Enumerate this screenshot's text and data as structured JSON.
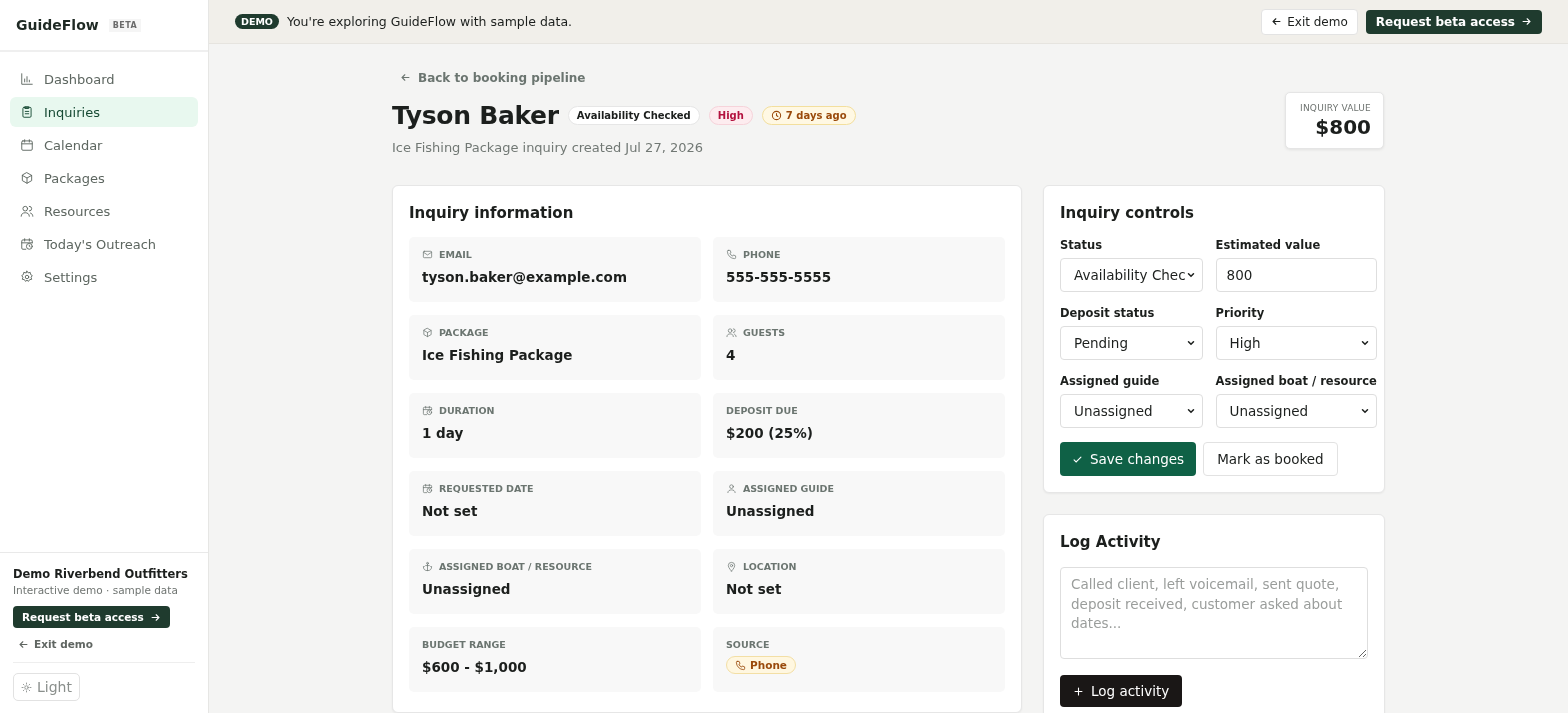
{
  "sidebar": {
    "brand": "GuideFlow",
    "brand_badge": "BETA",
    "items": [
      {
        "label": "Dashboard",
        "selected": false
      },
      {
        "label": "Inquiries",
        "selected": true
      },
      {
        "label": "Calendar",
        "selected": false
      },
      {
        "label": "Packages",
        "selected": false
      },
      {
        "label": "Resources",
        "selected": false
      },
      {
        "label": "Today's Outreach",
        "selected": false
      },
      {
        "label": "Settings",
        "selected": false
      }
    ],
    "org_name": "Demo Riverbend Outfitters",
    "org_note": "Interactive demo · sample data",
    "request_button": "Request beta access",
    "exit_link": "Exit demo",
    "theme_button": "Light"
  },
  "banner": {
    "badge": "DEMO",
    "message": "You're exploring GuideFlow with sample data.",
    "exit_button": "Exit demo",
    "request_button": "Request beta access"
  },
  "header": {
    "back_link": "Back to booking pipeline",
    "title": "Tyson Baker",
    "tags": [
      {
        "kind": "status",
        "label": "Availability Checked"
      },
      {
        "kind": "priority",
        "label": "High"
      },
      {
        "kind": "age",
        "label": "7 days ago"
      }
    ],
    "subtitle": "Ice Fishing Package inquiry created Jul 27, 2026",
    "value_label": "INQUIRY VALUE",
    "value": "$800"
  },
  "info": {
    "title": "Inquiry information",
    "fields": [
      {
        "label": "EMAIL",
        "value": "tyson.baker@example.com",
        "kind": "text"
      },
      {
        "label": "PHONE",
        "value": "555-555-5555",
        "kind": "text"
      },
      {
        "label": "PACKAGE",
        "value": "Ice Fishing Package",
        "kind": "text"
      },
      {
        "label": "GUESTS",
        "value": "4",
        "kind": "text"
      },
      {
        "label": "DURATION",
        "value": "1 day",
        "kind": "text"
      },
      {
        "label": "DEPOSIT DUE",
        "value": "$200 (25%)",
        "kind": "text"
      },
      {
        "label": "REQUESTED DATE",
        "value": "Not set",
        "kind": "text"
      },
      {
        "label": "ASSIGNED GUIDE",
        "value": "Unassigned",
        "kind": "text"
      },
      {
        "label": "ASSIGNED BOAT / RESOURCE",
        "value": "Unassigned",
        "kind": "text"
      },
      {
        "label": "LOCATION",
        "value": "Not set",
        "kind": "text"
      },
      {
        "label": "BUDGET RANGE",
        "value": "$600 - $1,000",
        "kind": "text"
      },
      {
        "label": "SOURCE",
        "value": "Phone",
        "kind": "badge"
      }
    ]
  },
  "controls": {
    "title": "Inquiry controls",
    "fields": [
      {
        "label": "Status",
        "value": "Availability Chec",
        "kind": "select"
      },
      {
        "label": "Estimated value",
        "value": "800",
        "kind": "input"
      },
      {
        "label": "Deposit status",
        "value": "Pending",
        "kind": "select"
      },
      {
        "label": "Priority",
        "value": "High",
        "kind": "select"
      },
      {
        "label": "Assigned guide",
        "value": "Unassigned",
        "kind": "select"
      },
      {
        "label": "Assigned boat / resource",
        "value": "Unassigned",
        "kind": "select"
      }
    ],
    "save_button": "Save changes",
    "booked_button": "Mark as booked"
  },
  "activity": {
    "title": "Log Activity",
    "placeholder": "Called client, left voicemail, sent quote, deposit received, customer asked about dates...",
    "button": "Log activity"
  }
}
